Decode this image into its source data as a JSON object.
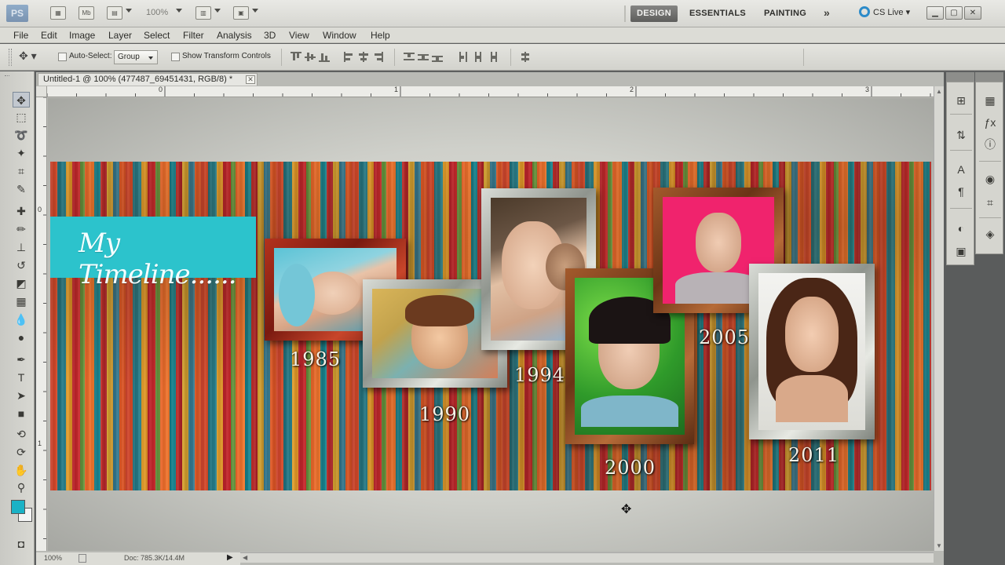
{
  "app": {
    "logo": "PS",
    "mb_label": "Mb",
    "zoom_label": "100%",
    "workspaces": [
      "DESIGN",
      "ESSENTIALS",
      "PAINTING"
    ],
    "more": "»",
    "cs_live": "CS Live"
  },
  "menu": [
    "File",
    "Edit",
    "Image",
    "Layer",
    "Select",
    "Filter",
    "Analysis",
    "3D",
    "View",
    "Window",
    "Help"
  ],
  "options": {
    "auto_select_label": "Auto-Select:",
    "auto_select_value": "Group",
    "show_transform_label": "Show Transform Controls"
  },
  "document": {
    "tab_title": "Untitled-1 @ 100% (477487_69451431, RGB/8) *",
    "ruler_top": [
      "0",
      "1",
      "2",
      "3"
    ],
    "ruler_left": [
      "0",
      "1"
    ],
    "status_zoom": "100%",
    "status_doc": "Doc: 785.3K/14.4M"
  },
  "artwork": {
    "title": "My Timeline......",
    "years": [
      "1985",
      "1990",
      "1994",
      "2000",
      "2005",
      "2011"
    ]
  },
  "colors": {
    "foreground": "#1ab2c6",
    "background": "#f4f4f4",
    "banner": "#2cc3cc"
  }
}
